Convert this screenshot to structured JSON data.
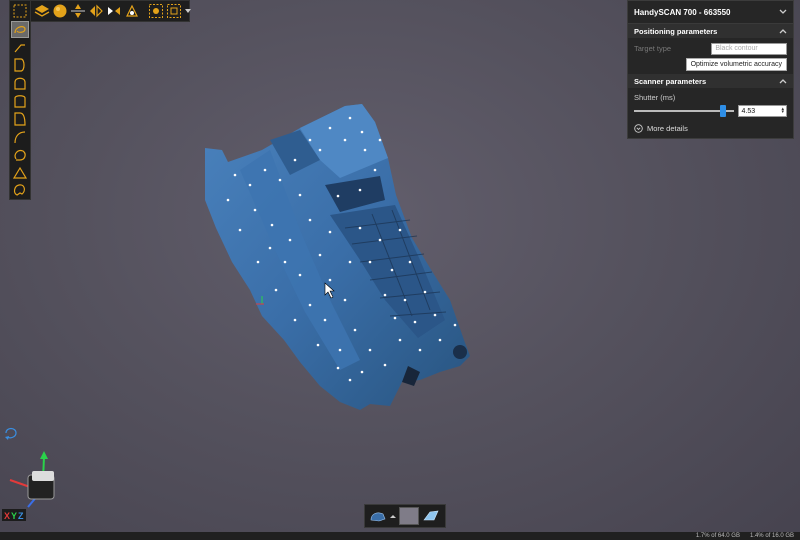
{
  "panel": {
    "title": "HandySCAN 700 - 663550",
    "positioning": {
      "header": "Positioning parameters",
      "target_type_label": "Target type",
      "target_type_value": "Black contour",
      "optimize_button": "Optimize volumetric accuracy"
    },
    "scanner": {
      "header": "Scanner parameters",
      "shutter_label": "Shutter (ms)",
      "shutter_value": "4.53",
      "shutter_level": 0.86,
      "more_details": "More details"
    }
  },
  "axes_label": {
    "x": "X",
    "y": "Y",
    "z": "Z"
  },
  "status": {
    "cpu": "1.7%",
    "mem": "of 64.0 GB",
    "gpu": "1.4%",
    "gpu_mem": "of 16.0 GB"
  },
  "colors": {
    "scan_blue": "#3a6ea8",
    "accent_orange": "#e3a21a",
    "slider_blue": "#2e8ee6"
  }
}
